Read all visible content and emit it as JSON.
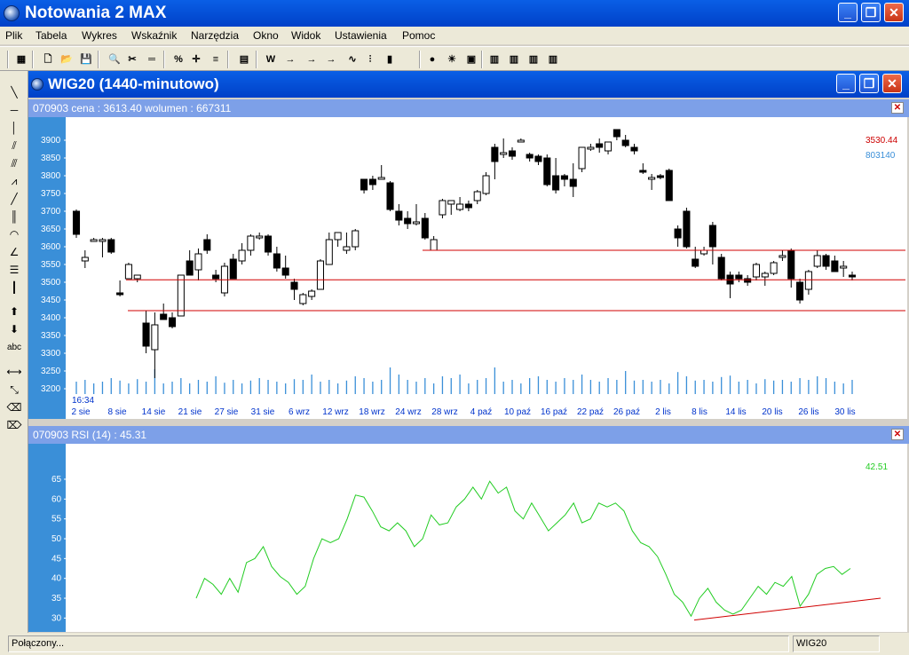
{
  "app": {
    "title": "Notowania 2 MAX"
  },
  "window_controls": {
    "minimize": "_",
    "maximize": "❐",
    "close": "✕"
  },
  "menu": [
    "Plik",
    "Tabela",
    "Wykres",
    "Wskaźnik",
    "Narzędzia",
    "Okno",
    "Widok",
    "Ustawienia",
    "Pomoc"
  ],
  "toolbar": {
    "buttons": [
      {
        "icon": "grid-icon",
        "glyph": "▦"
      },
      {
        "icon": "new-file-icon",
        "glyph": "🗋"
      },
      {
        "icon": "open-folder-icon",
        "glyph": "📂"
      },
      {
        "icon": "save-icon",
        "glyph": "💾"
      },
      {
        "icon": "zoom-icon",
        "glyph": "🔍"
      },
      {
        "icon": "scissors-icon",
        "glyph": "✂"
      },
      {
        "icon": "ruler-icon",
        "glyph": "═"
      },
      {
        "icon": "fibonacci-icon",
        "glyph": "%"
      },
      {
        "icon": "crosshair-icon",
        "glyph": "✛"
      },
      {
        "icon": "levels-icon",
        "glyph": "≡"
      },
      {
        "icon": "table-icon",
        "glyph": "▤"
      },
      {
        "icon": "weighted-line-icon",
        "glyph": "W"
      },
      {
        "icon": "arrow-right-icon",
        "glyph": "→"
      },
      {
        "icon": "arrow-right2-icon",
        "glyph": "→"
      },
      {
        "icon": "arrow-right3-icon",
        "glyph": "→"
      },
      {
        "icon": "line-chart-icon",
        "glyph": "∿"
      },
      {
        "icon": "bar-chart-icon",
        "glyph": "⫶"
      },
      {
        "icon": "candlestick-icon",
        "glyph": "▮"
      },
      {
        "icon": "traffic-light-icon",
        "glyph": "●"
      },
      {
        "icon": "bulb-icon",
        "glyph": "☀"
      },
      {
        "icon": "image-icon",
        "glyph": "▣"
      },
      {
        "icon": "layout1-icon",
        "glyph": "▥"
      },
      {
        "icon": "layout2-icon",
        "glyph": "▥"
      },
      {
        "icon": "layout3-icon",
        "glyph": "▥"
      },
      {
        "icon": "layout4-icon",
        "glyph": "▥"
      }
    ]
  },
  "palette": [
    {
      "icon": "line-tool-icon",
      "glyph": "╲"
    },
    {
      "icon": "hline-tool-icon",
      "glyph": "─"
    },
    {
      "icon": "vline-tool-icon",
      "glyph": "│"
    },
    {
      "icon": "channel-tool-icon",
      "glyph": "⫽"
    },
    {
      "icon": "pitchfork-tool-icon",
      "glyph": "⫻"
    },
    {
      "icon": "fan-tool-icon",
      "glyph": "⩘"
    },
    {
      "icon": "diagonal-tool-icon",
      "glyph": "╱"
    },
    {
      "icon": "cycles-tool-icon",
      "glyph": "║"
    },
    {
      "icon": "arcs-tool-icon",
      "glyph": "◠"
    },
    {
      "icon": "angle-tool-icon",
      "glyph": "∠"
    },
    {
      "icon": "retracement-tool-icon",
      "glyph": "☰"
    },
    {
      "icon": "time-zones-tool-icon",
      "glyph": "┃"
    },
    {
      "icon": "buy-arrow-icon",
      "glyph": "⬆"
    },
    {
      "icon": "sell-arrow-icon",
      "glyph": "⬇"
    },
    {
      "icon": "text-tool-icon",
      "glyph": "abc"
    },
    {
      "icon": "move-tool-icon",
      "glyph": "⟷"
    },
    {
      "icon": "shrink-tool-icon",
      "glyph": "⤡"
    },
    {
      "icon": "eraser-icon",
      "glyph": "⌫"
    },
    {
      "icon": "eraser-all-icon",
      "glyph": "⌦"
    }
  ],
  "chart_window": {
    "title": "WIG20 (1440-minutowo)"
  },
  "price_pane": {
    "header": "070903  cena : 3613.40 wolumen : 667311",
    "last_price": "3530.44",
    "last_volume": "803140",
    "time_label": "16:34",
    "colors": {
      "up": "#ffffff",
      "down": "#000000",
      "support_lines": "#d00000",
      "volume": "#3a8fd8",
      "axis_bg": "#3a8fd8"
    }
  },
  "rsi_pane": {
    "header": "070903  RSI (14) : 45.31",
    "last_value": "42.51",
    "colors": {
      "rsi_line": "#22cc22",
      "trend_line": "#d00000"
    }
  },
  "chart_data": [
    {
      "type": "candlestick",
      "title": "WIG20",
      "y_ticks": [
        3900,
        3850,
        3800,
        3750,
        3700,
        3650,
        3600,
        3550,
        3500,
        3450,
        3400,
        3350,
        3300,
        3250,
        3200
      ],
      "ylim": [
        3190,
        3940
      ],
      "x_ticks": [
        "2 sie",
        "8 sie",
        "14 sie",
        "21 sie",
        "27 sie",
        "31 sie",
        "6 wrz",
        "12 wrz",
        "18 wrz",
        "24 wrz",
        "28 wrz",
        "4 paź",
        "10 paź",
        "16 paź",
        "22 paź",
        "26 paź",
        "2 lis",
        "8 lis",
        "14 lis",
        "20 lis",
        "26 lis",
        "30 lis"
      ],
      "horizontal_lines": [
        3590,
        3507,
        3420
      ],
      "candles": [
        [
          3700,
          3705,
          3625,
          3635
        ],
        [
          3560,
          3590,
          3540,
          3570
        ],
        [
          3620,
          3625,
          3615,
          3620
        ],
        [
          3620,
          3625,
          3570,
          3620
        ],
        [
          3620,
          3625,
          3580,
          3585
        ],
        [
          3470,
          3505,
          3460,
          3465
        ],
        [
          3510,
          3555,
          3510,
          3550
        ],
        [
          3510,
          3520,
          3500,
          3520
        ],
        [
          3385,
          3420,
          3300,
          3320
        ],
        [
          3310,
          3415,
          3230,
          3380
        ],
        [
          3410,
          3440,
          3395,
          3395
        ],
        [
          3400,
          3415,
          3370,
          3375
        ],
        [
          3405,
          3520,
          3405,
          3520
        ],
        [
          3560,
          3590,
          3520,
          3520
        ],
        [
          3535,
          3595,
          3505,
          3580
        ],
        [
          3620,
          3635,
          3580,
          3590
        ],
        [
          3520,
          3535,
          3500,
          3510
        ],
        [
          3470,
          3555,
          3460,
          3545
        ],
        [
          3565,
          3580,
          3510,
          3510
        ],
        [
          3560,
          3610,
          3550,
          3590
        ],
        [
          3590,
          3635,
          3575,
          3630
        ],
        [
          3630,
          3640,
          3620,
          3630
        ],
        [
          3630,
          3635,
          3575,
          3585
        ],
        [
          3580,
          3600,
          3530,
          3540
        ],
        [
          3540,
          3575,
          3510,
          3520
        ],
        [
          3500,
          3510,
          3450,
          3480
        ],
        [
          3440,
          3470,
          3435,
          3465
        ],
        [
          3460,
          3480,
          3450,
          3475
        ],
        [
          3480,
          3565,
          3480,
          3560
        ],
        [
          3550,
          3640,
          3550,
          3620
        ],
        [
          3620,
          3640,
          3600,
          3640
        ],
        [
          3590,
          3640,
          3580,
          3600
        ],
        [
          3600,
          3650,
          3590,
          3645
        ],
        [
          3790,
          3790,
          3750,
          3760
        ],
        [
          3790,
          3800,
          3760,
          3775
        ],
        [
          3790,
          3830,
          3790,
          3795
        ],
        [
          3780,
          3785,
          3700,
          3705
        ],
        [
          3700,
          3720,
          3660,
          3675
        ],
        [
          3680,
          3700,
          3650,
          3665
        ],
        [
          3665,
          3720,
          3660,
          3670
        ],
        [
          3680,
          3695,
          3620,
          3625
        ],
        [
          3590,
          3630,
          3590,
          3620
        ],
        [
          3690,
          3735,
          3680,
          3730
        ],
        [
          3720,
          3730,
          3690,
          3730
        ],
        [
          3705,
          3740,
          3700,
          3720
        ],
        [
          3720,
          3730,
          3700,
          3710
        ],
        [
          3730,
          3760,
          3720,
          3755
        ],
        [
          3750,
          3810,
          3745,
          3800
        ],
        [
          3880,
          3890,
          3790,
          3840
        ],
        [
          3860,
          3905,
          3850,
          3865
        ],
        [
          3870,
          3880,
          3845,
          3855
        ],
        [
          3900,
          3905,
          3895,
          3900
        ],
        [
          3860,
          3865,
          3840,
          3850
        ],
        [
          3855,
          3860,
          3830,
          3840
        ],
        [
          3850,
          3860,
          3770,
          3775
        ],
        [
          3800,
          3850,
          3750,
          3760
        ],
        [
          3800,
          3805,
          3770,
          3790
        ],
        [
          3790,
          3835,
          3740,
          3770
        ],
        [
          3820,
          3880,
          3810,
          3880
        ],
        [
          3880,
          3890,
          3870,
          3880
        ],
        [
          3890,
          3905,
          3865,
          3880
        ],
        [
          3870,
          3895,
          3860,
          3895
        ],
        [
          3930,
          3930,
          3900,
          3910
        ],
        [
          3900,
          3915,
          3880,
          3885
        ],
        [
          3880,
          3890,
          3860,
          3870
        ],
        [
          3815,
          3835,
          3805,
          3810
        ],
        [
          3795,
          3805,
          3760,
          3795
        ],
        [
          3800,
          3805,
          3790,
          3795
        ],
        [
          3815,
          3820,
          3730,
          3730
        ],
        [
          3650,
          3660,
          3600,
          3625
        ],
        [
          3700,
          3710,
          3595,
          3600
        ],
        [
          3565,
          3600,
          3540,
          3545
        ],
        [
          3580,
          3600,
          3575,
          3590
        ],
        [
          3660,
          3670,
          3550,
          3600
        ],
        [
          3570,
          3580,
          3505,
          3510
        ],
        [
          3520,
          3530,
          3455,
          3495
        ],
        [
          3520,
          3530,
          3500,
          3510
        ],
        [
          3510,
          3520,
          3490,
          3500
        ],
        [
          3515,
          3555,
          3505,
          3550
        ],
        [
          3515,
          3530,
          3490,
          3525
        ],
        [
          3525,
          3560,
          3520,
          3555
        ],
        [
          3575,
          3590,
          3560,
          3575
        ],
        [
          3590,
          3595,
          3485,
          3510
        ],
        [
          3500,
          3510,
          3440,
          3450
        ],
        [
          3480,
          3535,
          3465,
          3530
        ],
        [
          3545,
          3590,
          3540,
          3575
        ],
        [
          3575,
          3580,
          3535,
          3545
        ],
        [
          3560,
          3575,
          3530,
          3530
        ],
        [
          3540,
          3560,
          3515,
          3545
        ],
        [
          3520,
          3530,
          3505,
          3515
        ]
      ],
      "volume_relative": [
        0.35,
        0.4,
        0.3,
        0.35,
        0.45,
        0.38,
        0.3,
        0.42,
        0.35,
        0.7,
        0.3,
        0.35,
        0.45,
        0.3,
        0.4,
        0.35,
        0.5,
        0.32,
        0.4,
        0.3,
        0.38,
        0.45,
        0.4,
        0.35,
        0.3,
        0.42,
        0.4,
        0.55,
        0.35,
        0.4,
        0.3,
        0.38,
        0.5,
        0.45,
        0.35,
        0.4,
        0.75,
        0.55,
        0.4,
        0.35,
        0.45,
        0.3,
        0.5,
        0.45,
        0.55,
        0.3,
        0.4,
        0.45,
        0.75,
        0.35,
        0.4,
        0.3,
        0.45,
        0.5,
        0.4,
        0.35,
        0.45,
        0.4,
        0.55,
        0.4,
        0.35,
        0.45,
        0.4,
        0.65,
        0.38,
        0.4,
        0.35,
        0.4,
        0.3,
        0.62,
        0.5,
        0.38,
        0.4,
        0.35,
        0.48,
        0.52,
        0.35,
        0.4,
        0.3,
        0.42,
        0.38,
        0.4,
        0.35,
        0.45,
        0.4,
        0.5,
        0.45,
        0.35,
        0.3,
        0.4
      ]
    },
    {
      "type": "line",
      "title": "RSI (14)",
      "y_ticks": [
        65,
        60,
        55,
        50,
        45,
        40,
        35,
        30
      ],
      "ylim": [
        26,
        68
      ],
      "values": [
        35,
        40,
        38.5,
        36,
        40,
        36.5,
        44,
        45,
        48,
        43,
        40.5,
        39,
        36,
        38,
        45,
        50,
        49,
        50,
        55,
        61,
        60.5,
        57,
        53,
        52,
        54,
        52,
        48,
        50,
        56,
        53.5,
        54,
        58,
        60,
        63,
        60,
        64.5,
        61.5,
        63,
        57,
        55,
        59,
        55.5,
        52,
        54,
        56,
        59,
        54,
        55,
        59,
        58,
        59,
        57,
        52,
        49,
        48,
        45.5,
        41,
        36,
        34,
        30.5,
        35,
        37.5,
        34,
        32,
        31,
        32,
        35,
        38,
        36,
        39,
        38,
        40.5,
        33,
        36,
        41,
        42.5,
        43,
        41,
        42.5
      ],
      "trend_line": [
        [
          29.5
        ],
        [
          35
        ]
      ]
    }
  ],
  "status": {
    "left": "Połączony...",
    "symbol": "WIG20"
  }
}
